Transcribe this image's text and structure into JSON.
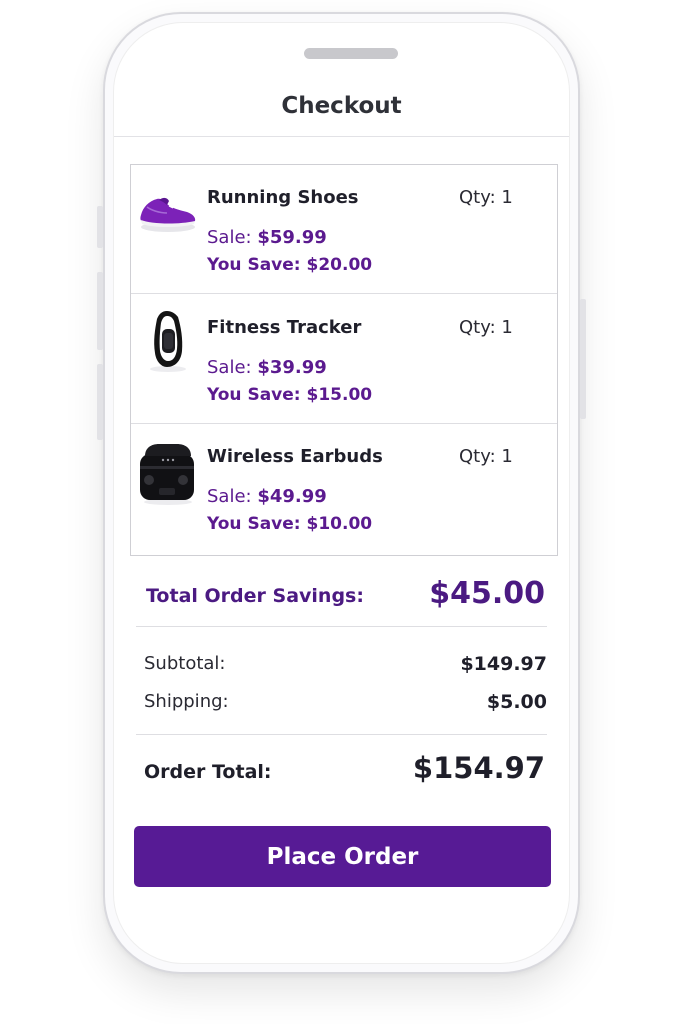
{
  "header": {
    "title": "Checkout"
  },
  "cart": {
    "items": [
      {
        "name": "Running Shoes",
        "qty_label": "Qty: 1",
        "sale_label": "Sale:",
        "sale_price": "$59.99",
        "save_label": "You Save:",
        "save_amount": "$20.00",
        "icon": "shoe-icon"
      },
      {
        "name": "Fitness Tracker",
        "qty_label": "Qty: 1",
        "sale_label": "Sale:",
        "sale_price": "$39.99",
        "save_label": "You Save:",
        "save_amount": "$15.00",
        "icon": "fitness-tracker-icon"
      },
      {
        "name": "Wireless Earbuds",
        "qty_label": "Qty: 1",
        "sale_label": "Sale:",
        "sale_price": "$49.99",
        "save_label": "You Save:",
        "save_amount": "$10.00",
        "icon": "earbuds-case-icon"
      }
    ]
  },
  "summary": {
    "savings_label": "Total Order Savings:",
    "savings_value": "$45.00",
    "subtotal_label": "Subtotal:",
    "subtotal_value": "$149.97",
    "shipping_label": "Shipping:",
    "shipping_value": "$5.00",
    "total_label": "Order Total:",
    "total_value": "$154.97"
  },
  "actions": {
    "place_order": "Place Order"
  },
  "colors": {
    "accent": "#571b95",
    "accent_text": "#5b1a8f",
    "text": "#1f1f2a"
  }
}
